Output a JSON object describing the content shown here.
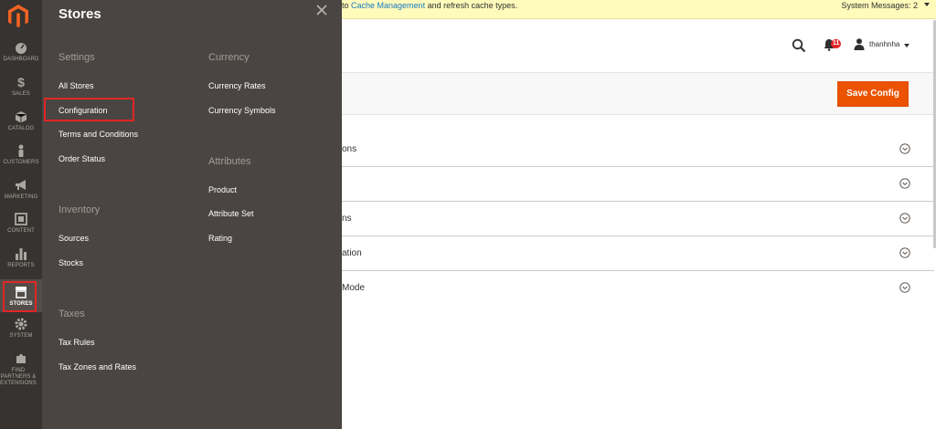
{
  "nav": {
    "items": [
      {
        "label": "DASHBOARD",
        "icon": "dashboard-icon"
      },
      {
        "label": "SALES",
        "icon": "dollar-icon"
      },
      {
        "label": "CATALOG",
        "icon": "cube-icon"
      },
      {
        "label": "CUSTOMERS",
        "icon": "person-icon"
      },
      {
        "label": "MARKETING",
        "icon": "megaphone-icon"
      },
      {
        "label": "CONTENT",
        "icon": "layout-icon"
      },
      {
        "label": "REPORTS",
        "icon": "bar-chart-icon"
      },
      {
        "label": "STORES",
        "icon": "storefront-icon"
      },
      {
        "label": "SYSTEM",
        "icon": "gear-icon"
      },
      {
        "label": "FIND PARTNERS & EXTENSIONS",
        "icon": "puzzle-icon"
      }
    ]
  },
  "flyout": {
    "title": "Stores",
    "settings": {
      "heading": "Settings",
      "links": [
        "All Stores",
        "Configuration",
        "Terms and Conditions",
        "Order Status"
      ]
    },
    "inventory": {
      "heading": "Inventory",
      "links": [
        "Sources",
        "Stocks"
      ]
    },
    "taxes": {
      "heading": "Taxes",
      "links": [
        "Tax Rules",
        "Tax Zones and Rates"
      ]
    },
    "currency": {
      "heading": "Currency",
      "links": [
        "Currency Rates",
        "Currency Symbols"
      ]
    },
    "attributes": {
      "heading": "Attributes",
      "links": [
        "Product",
        "Attribute Set",
        "Rating"
      ]
    }
  },
  "notice": {
    "prefix": "to ",
    "link": "Cache Management",
    "suffix": " and refresh cache types.",
    "system_messages": "System Messages: 2"
  },
  "header": {
    "notifications_count": "11",
    "user_name": "thanhnha"
  },
  "actions": {
    "save_label": "Save Config"
  },
  "sections": [
    {
      "label": "ons"
    },
    {
      "label": ""
    },
    {
      "label": "ns"
    },
    {
      "label": "ation"
    },
    {
      "label": "Mode"
    }
  ],
  "colors": {
    "nav_bg": "#373330",
    "flyout_bg": "#4a4542",
    "accent": "#eb5202",
    "highlight_red": "#e22626",
    "notice_bg": "#fffbbb",
    "link_blue": "#1979c3"
  }
}
